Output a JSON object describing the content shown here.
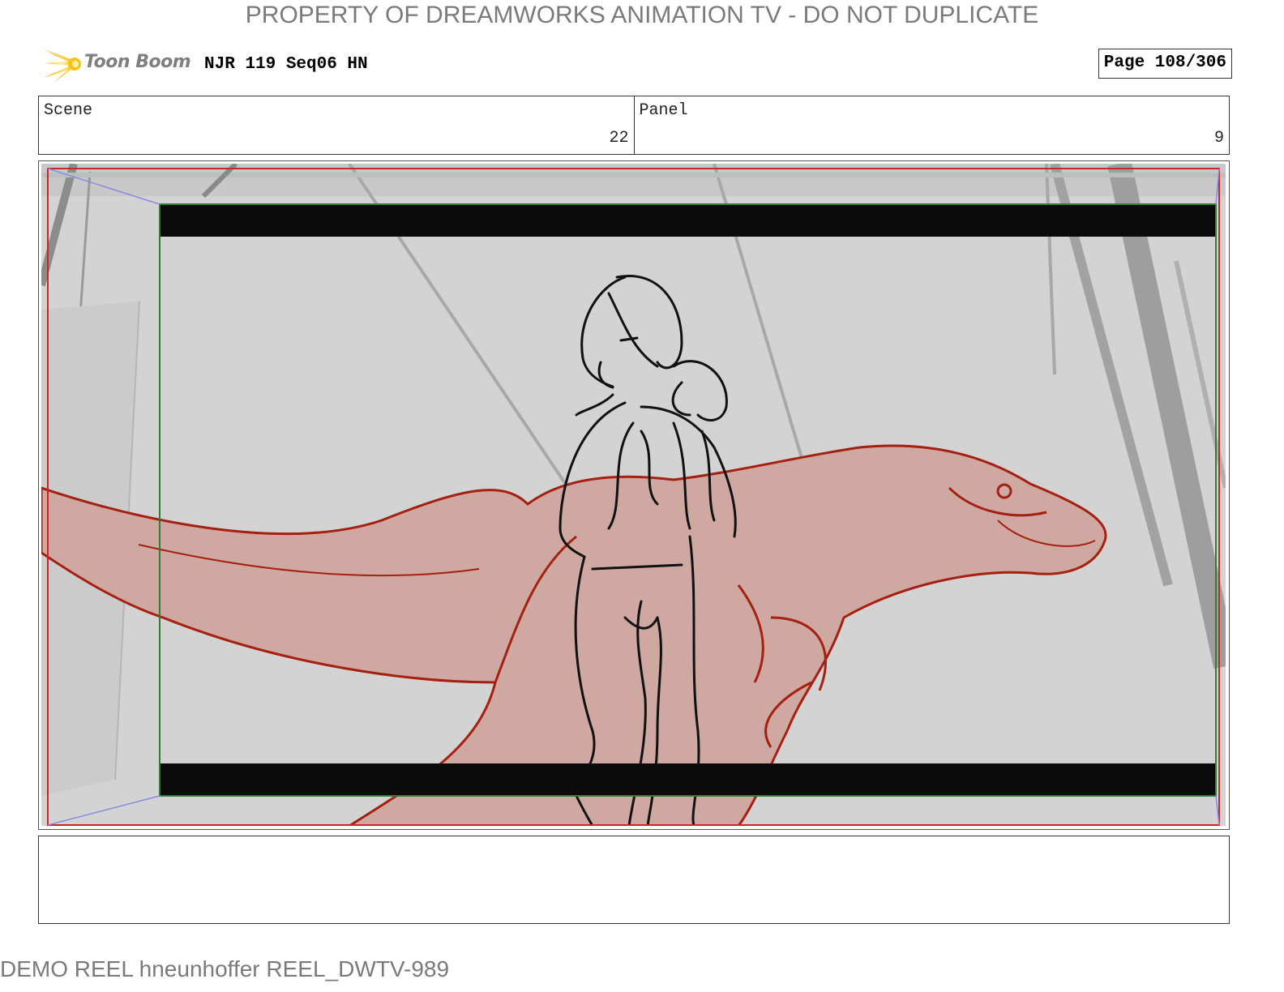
{
  "watermark_top": "PROPERTY OF DREAMWORKS ANIMATION TV - DO NOT DUPLICATE",
  "header": {
    "logo_text": "Toon Boom",
    "project_title": "NJR 119 Seq06 HN",
    "page_number": "Page 108/306"
  },
  "info": {
    "scene_label": "Scene",
    "scene_value": "22",
    "panel_label": "Panel",
    "panel_value": "9"
  },
  "panel": {
    "icons": [
      "woman-figure-sketch",
      "dinosaur-sketch"
    ],
    "colors": {
      "background": "#d2d2d2",
      "dinosaur_fill": "#cfa8a2",
      "dinosaur_line": "#a52010",
      "camera_frame": "#2e7d32",
      "safe_frame": "#c62828",
      "letterbox": "#0b0b0b"
    }
  },
  "caption": "",
  "watermark_bottom": "DEMO REEL hneunhoffer REEL_DWTV-989"
}
